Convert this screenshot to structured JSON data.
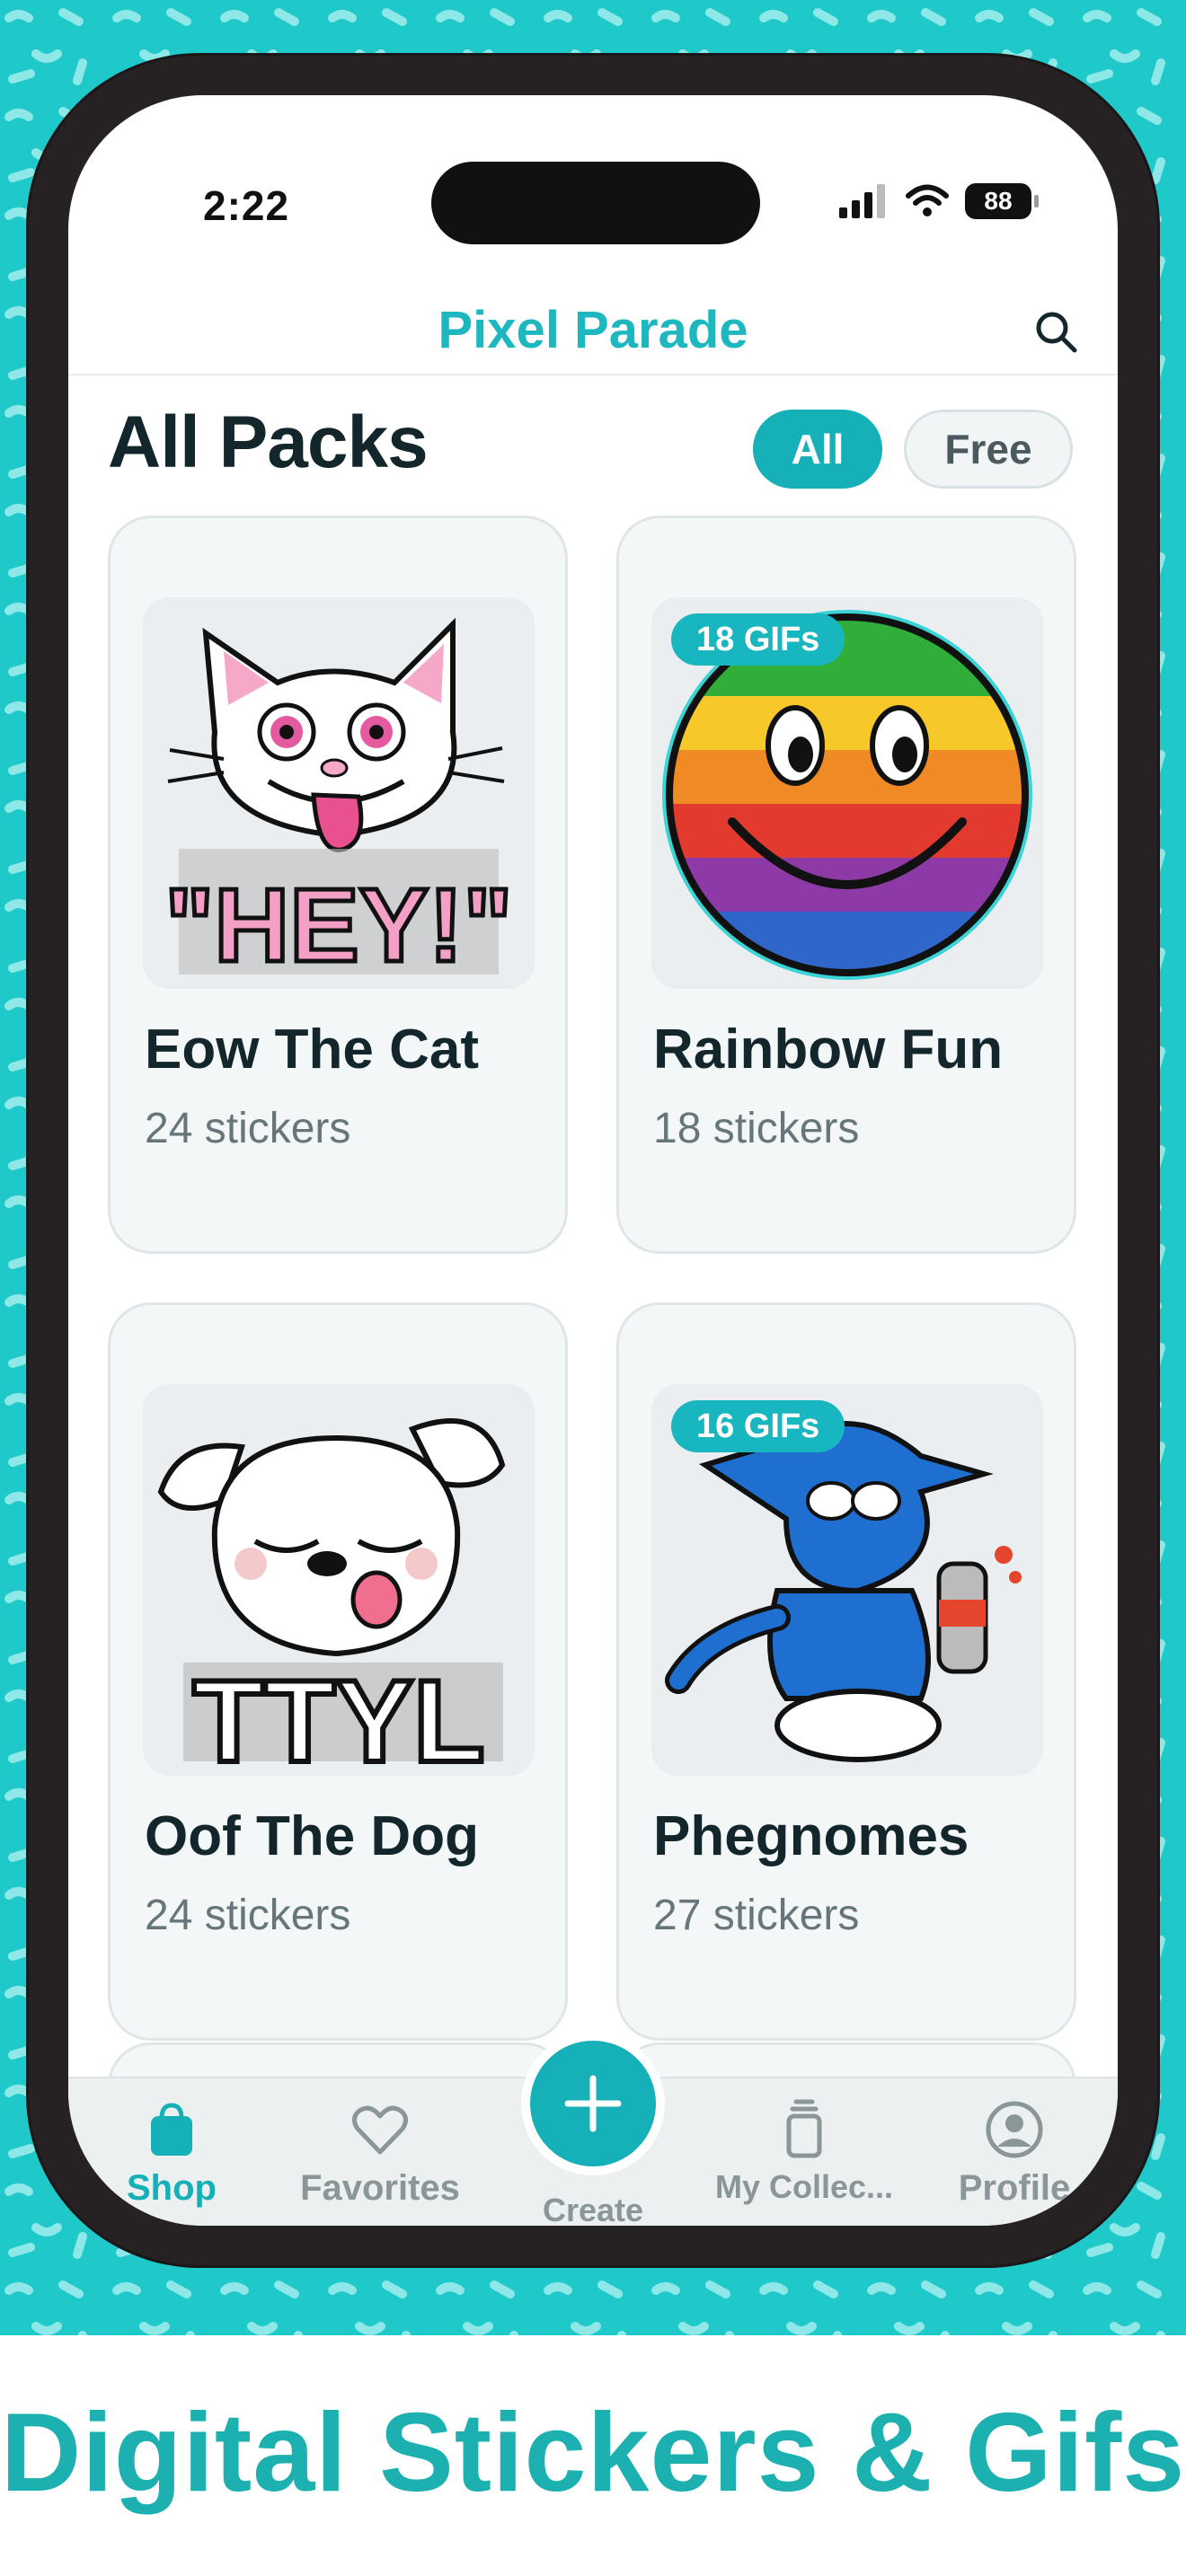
{
  "status_bar": {
    "time": "2:22",
    "battery": "88"
  },
  "app": {
    "title": "Pixel Parade"
  },
  "section": {
    "title": "All Packs"
  },
  "filters": [
    {
      "label": "All",
      "active": true
    },
    {
      "label": "Free",
      "active": false
    }
  ],
  "packs": [
    {
      "name": "Eow The Cat",
      "count": "24 stickers",
      "badge": "",
      "sticker_text": "\"HEY!\""
    },
    {
      "name": "Rainbow Fun",
      "count": "18 stickers",
      "badge": "18 GIFs"
    },
    {
      "name": "Oof The Dog",
      "count": "24 stickers",
      "badge": "",
      "sticker_text": "TTYL"
    },
    {
      "name": "Phegnomes",
      "count": "27 stickers",
      "badge": "16 GIFs"
    }
  ],
  "tabbar": {
    "items": [
      {
        "label": "Shop",
        "icon": "shopping-bag-icon",
        "active": true
      },
      {
        "label": "Favorites",
        "icon": "heart-icon"
      },
      {
        "label": "Create",
        "icon": "plus-icon"
      },
      {
        "label": "My Collec...",
        "icon": "stack-icon"
      },
      {
        "label": "Profile",
        "icon": "profile-icon"
      }
    ]
  },
  "caption": "Digital Stickers & Gifs",
  "colors": {
    "accent": "#15b0b8",
    "background_pattern": "#1fc9c9",
    "caption": "#1db0b0"
  }
}
